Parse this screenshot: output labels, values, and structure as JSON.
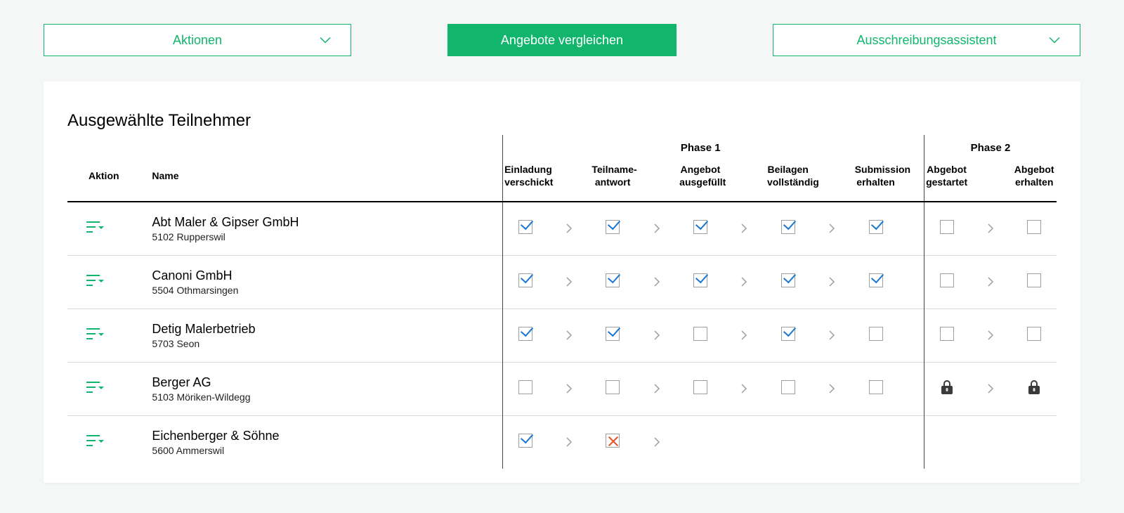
{
  "toolbar": {
    "actions_label": "Aktionen",
    "compare_label": "Angebote vergleichen",
    "assistant_label": "Ausschreibungsassistent"
  },
  "section_title": "Ausgewählte Teilnehmer",
  "columns": {
    "action": "Aktion",
    "name": "Name",
    "phase1_label": "Phase 1",
    "phase2_label": "Phase 2",
    "p1": {
      "c1a": "Einladung",
      "c1b": "verschickt",
      "c2a": "Teilname-",
      "c2b": "antwort",
      "c3a": "Angebot",
      "c3b": "ausgefüllt",
      "c4a": "Beilagen",
      "c4b": "vollständig",
      "c5a": "Submission",
      "c5b": "erhalten"
    },
    "p2": {
      "c1a": "Abgebot",
      "c1b": "gestartet",
      "c2a": "Abgebot",
      "c2b": "erhalten"
    }
  },
  "rows": [
    {
      "name": "Abt Maler & Gipser GmbH",
      "location": "5102 Rupperswil",
      "phase1": [
        "checked",
        "checked",
        "checked",
        "checked",
        "checked"
      ],
      "phase2": [
        "empty",
        "empty"
      ]
    },
    {
      "name": "Canoni GmbH",
      "location": "5504 Othmarsingen",
      "phase1": [
        "checked",
        "checked",
        "checked",
        "checked",
        "checked"
      ],
      "phase2": [
        "empty",
        "empty"
      ]
    },
    {
      "name": "Detig Malerbetrieb",
      "location": "5703 Seon",
      "phase1": [
        "checked",
        "checked",
        "empty",
        "checked",
        "empty"
      ],
      "phase2": [
        "empty",
        "empty"
      ]
    },
    {
      "name": "Berger AG",
      "location": "5103 Möriken-Wildegg",
      "phase1": [
        "empty",
        "empty",
        "empty",
        "empty",
        "empty"
      ],
      "phase2": [
        "lock",
        "lock"
      ]
    },
    {
      "name": "Eichenberger & Söhne",
      "location": "5600 Ammerswil",
      "phase1": [
        "checked",
        "cross",
        "none",
        "none",
        "none"
      ],
      "phase2": [
        "none",
        "none"
      ]
    }
  ]
}
